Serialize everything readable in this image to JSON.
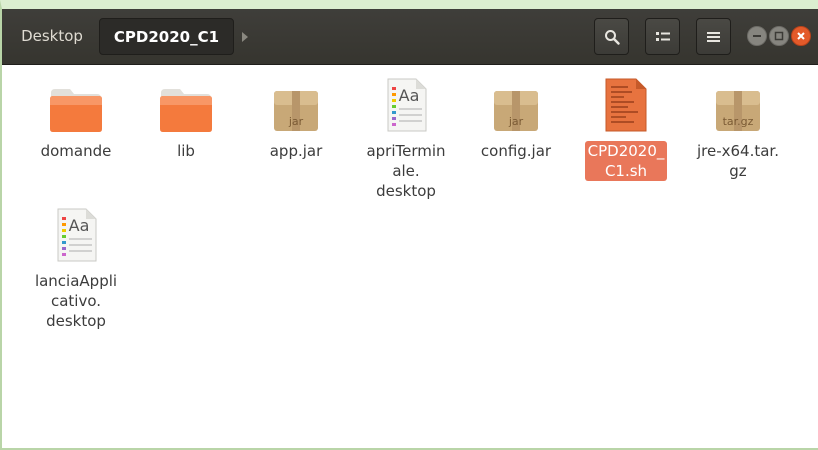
{
  "window": {
    "breadcrumb_parent": "Desktop",
    "breadcrumb_current": "CPD2020_C1"
  },
  "toolbar": {
    "icons": [
      "search-icon",
      "view-toggle-icon",
      "menu-icon"
    ],
    "window_controls": [
      "minimize-icon",
      "maximize-icon",
      "close-icon"
    ]
  },
  "colors": {
    "headerbar": "#3b3a36",
    "selection": "#e9775a",
    "folder": "#ef7138",
    "close": "#e35a2a"
  },
  "files": [
    {
      "label_lines": [
        "domande"
      ],
      "icon": "folder-icon",
      "selected": false
    },
    {
      "label_lines": [
        "lib"
      ],
      "icon": "folder-icon",
      "selected": false
    },
    {
      "label_lines": [
        "app.jar"
      ],
      "icon": "archive-icon",
      "badge": "jar",
      "selected": false
    },
    {
      "label_lines": [
        "apriTermin",
        "ale.",
        "desktop"
      ],
      "icon": "text-file-icon",
      "badge": "Aa",
      "selected": false
    },
    {
      "label_lines": [
        "config.jar"
      ],
      "icon": "archive-icon",
      "badge": "jar",
      "selected": false
    },
    {
      "label_lines": [
        "CPD2020_",
        "C1.sh"
      ],
      "icon": "script-file-icon",
      "selected": true
    },
    {
      "label_lines": [
        "jre-x64.tar.",
        "gz"
      ],
      "icon": "archive-icon",
      "badge": "tar.gz",
      "selected": false
    },
    {
      "label_lines": [
        "lanciaAppli",
        "cativo.",
        "desktop"
      ],
      "icon": "text-file-icon",
      "badge": "Aa",
      "selected": false
    }
  ]
}
